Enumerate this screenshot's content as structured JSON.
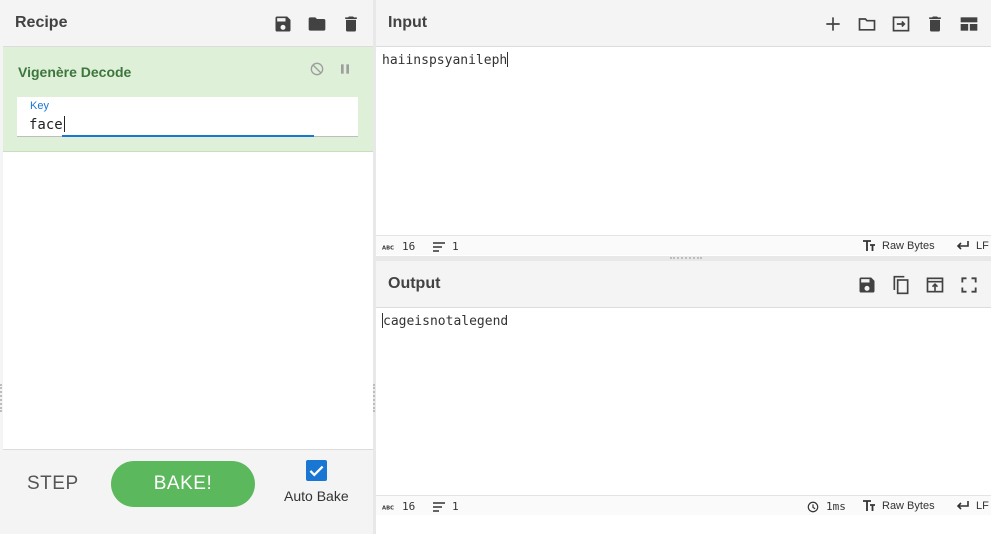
{
  "recipe": {
    "title": "Recipe",
    "icons": [
      "save-icon",
      "folder-icon",
      "trash-icon"
    ],
    "operation": {
      "name": "Vigenère Decode",
      "arg_label": "Key",
      "arg_value": "face"
    },
    "controls": {
      "step_label": "STEP",
      "bake_label": "BAKE!",
      "autobake_label": "Auto Bake",
      "autobake_checked": true
    }
  },
  "input": {
    "title": "Input",
    "icons": [
      "plus-icon",
      "folder-icon",
      "import-icon",
      "trash-icon",
      "layout-icon"
    ],
    "text": "haiinspsyanileph",
    "status": {
      "length": "16",
      "lines": "1",
      "encoding": "Raw Bytes",
      "eol": "LF"
    }
  },
  "output": {
    "title": "Output",
    "icons": [
      "save-icon",
      "copy-icon",
      "replace-input-icon",
      "fullscreen-icon"
    ],
    "text": "cageisnotalegend",
    "status": {
      "length": "16",
      "lines": "1",
      "time": "1ms",
      "encoding": "Raw Bytes",
      "eol": "LF"
    }
  },
  "colors": {
    "accent": "#1976d2",
    "bake": "#5cb85c",
    "operation_bg": "#dff0d8",
    "operation_title": "#3c763d"
  }
}
